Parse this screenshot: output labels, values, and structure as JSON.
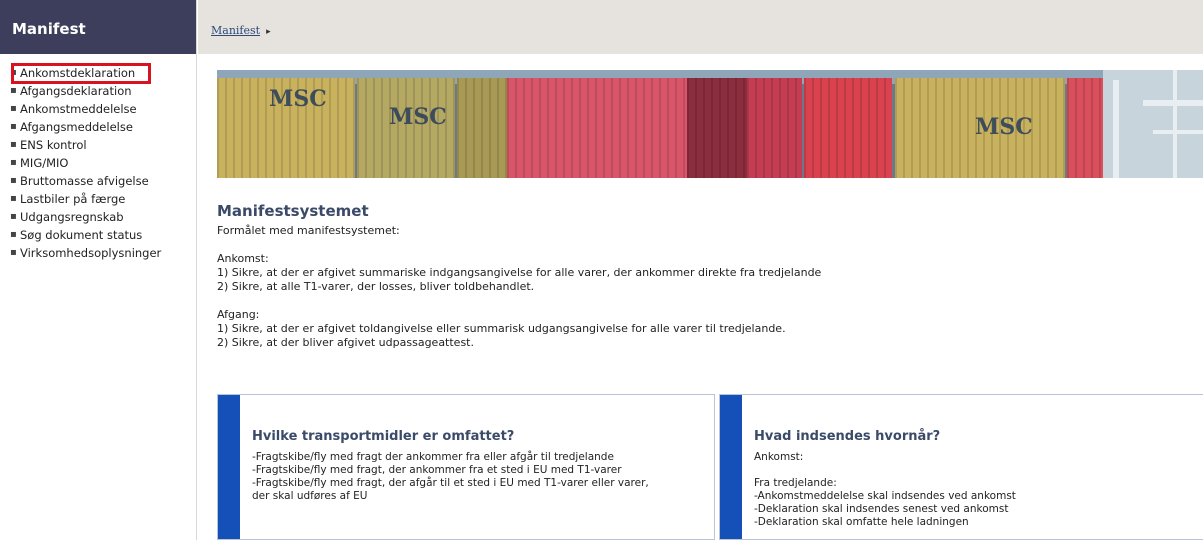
{
  "sidebar": {
    "title": "Manifest",
    "items": [
      {
        "label": "Ankomstdeklaration",
        "selected": true
      },
      {
        "label": "Afgangsdeklaration"
      },
      {
        "label": "Ankomstmeddelelse"
      },
      {
        "label": "Afgangsmeddelelse"
      },
      {
        "label": "ENS kontrol"
      },
      {
        "label": "MIG/MIO"
      },
      {
        "label": "Bruttomasse afvigelse"
      },
      {
        "label": "Lastbiler på færge"
      },
      {
        "label": "Udgangsregnskab"
      },
      {
        "label": "Søg dokument status"
      },
      {
        "label": "Virksomhedsoplysninger"
      }
    ],
    "bullet": "▪"
  },
  "breadcrumb": {
    "link": "Manifest",
    "separator": "▸"
  },
  "banner": {
    "logo_text": "MSC",
    "colors": [
      "#c9b25e",
      "#b4a863",
      "#d9566a",
      "#c43d52",
      "#8b2d3c",
      "#d8434f",
      "#c9b25e",
      "#d94f5b"
    ]
  },
  "main": {
    "title": "Manifestsystemet",
    "intro": "Formålet med manifestsystemet:",
    "arrival_heading": "Ankomst:",
    "arrival_1": "1) Sikre, at der er afgivet summariske indgangsangivelse for alle varer, der ankommer direkte fra tredjelande",
    "arrival_2": "2) Sikre, at alle T1-varer, der losses, bliver toldbehandlet.",
    "departure_heading": "Afgang:",
    "departure_1": "1) Sikre, at der er afgivet toldangivelse eller summarisk udgangsangivelse for alle varer til tredjelande.",
    "departure_2": "2) Sikre, at der bliver afgivet udpassageattest."
  },
  "card_left": {
    "title": "Hvilke transportmidler er omfattet?",
    "lines": [
      "-Fragtskibe/fly med fragt der ankommer fra eller afgår til tredjelande",
      "-Fragtskibe/fly med fragt, der ankommer fra et sted i EU med T1-varer",
      "-Fragtskibe/fly med fragt, der afgår til et sted i EU med T1-varer eller varer,",
      "der skal udføres af EU"
    ]
  },
  "card_right": {
    "title": "Hvad indsendes hvornår?",
    "lines": [
      "Ankomst:",
      "",
      "Fra tredjelande:",
      "-Ankomstmeddelelse skal indsendes ved ankomst",
      "-Deklaration skal indsendes senest ved ankomst",
      "-Deklaration skal omfatte hele ladningen"
    ]
  },
  "colors": {
    "sidebar_header_bg": "#3d3d5c",
    "topbar_bg": "#e6e3de",
    "card_stripe": "#1550b8",
    "highlight": "#d9121f",
    "heading": "#3a4a68"
  }
}
